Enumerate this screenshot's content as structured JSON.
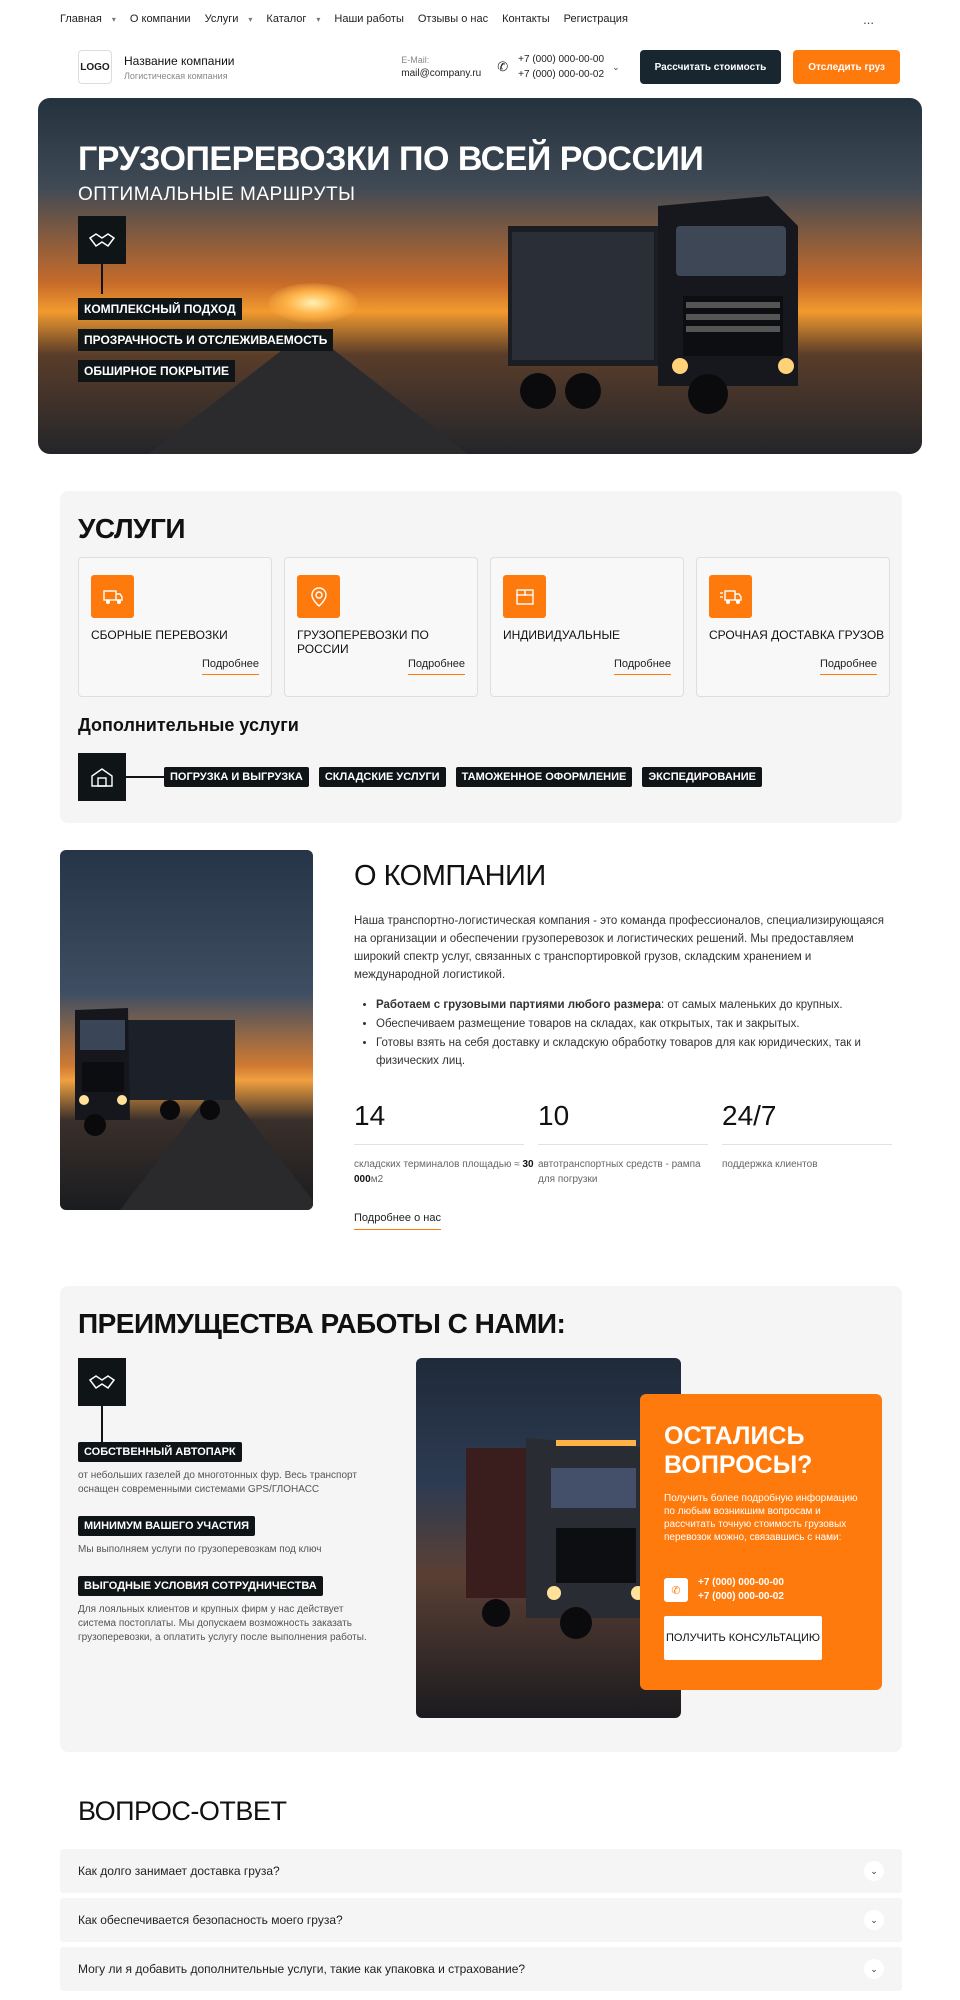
{
  "nav": {
    "items": [
      {
        "label": "Главная",
        "dropdown": true
      },
      {
        "label": "О компании",
        "dropdown": false
      },
      {
        "label": "Услуги",
        "dropdown": true
      },
      {
        "label": "Каталог",
        "dropdown": true
      },
      {
        "label": "Наши работы",
        "dropdown": false
      },
      {
        "label": "Отзывы о нас",
        "dropdown": false
      },
      {
        "label": "Контакты",
        "dropdown": false
      },
      {
        "label": "Регистрация",
        "dropdown": false
      }
    ],
    "more": "..."
  },
  "header": {
    "logo": "LOGO",
    "company_name": "Название компании",
    "company_sub": "Логистическая компания",
    "email_label": "E-Mail:",
    "email": "mail@company.ru",
    "phone1": "+7 (000) 000-00-00",
    "phone2": "+7 (000) 000-00-02",
    "btn_calc": "Рассчитать стоимость",
    "btn_track": "Отследить груз"
  },
  "hero": {
    "title": "ГРУЗОПЕРЕВОЗКИ ПО ВСЕЙ РОССИИ",
    "subtitle": "ОПТИМАЛЬНЫЕ МАРШРУТЫ",
    "tags": [
      "КОМПЛЕКСНЫЙ ПОДХОД",
      "ПРОЗРАЧНОСТЬ И ОТСЛЕЖИВАЕМОСТЬ",
      "ОБШИРНОЕ ПОКРЫТИЕ"
    ]
  },
  "services": {
    "title": "УСЛУГИ",
    "cards": [
      {
        "title": "СБОРНЫЕ ПЕРЕВОЗКИ",
        "more": "Подробнее",
        "icon": "box-truck-icon"
      },
      {
        "title": "ГРУЗОПЕРЕВОЗКИ ПО РОССИИ",
        "more": "Подробнее",
        "icon": "map-pin-icon"
      },
      {
        "title": "ИНДИВИДУАЛЬНЫЕ",
        "more": "Подробнее",
        "icon": "package-icon"
      },
      {
        "title": "СРОЧНАЯ ДОСТАВКА ГРУЗОВ",
        "more": "Подробнее",
        "icon": "fast-truck-icon"
      }
    ],
    "additional_title": "Дополнительные услуги",
    "additional": [
      "ПОГРУЗКА И ВЫГРУЗКА",
      "СКЛАДСКИЕ УСЛУГИ",
      "ТАМОЖЕННОЕ ОФОРМЛЕНИЕ",
      "ЭКСПЕДИРОВАНИЕ"
    ]
  },
  "about": {
    "title": "О КОМПАНИИ",
    "text": "Наша транспортно-логистическая компания - это команда профессионалов, специализирующаяся на организации и обеспечении грузоперевозок и логистических решений. Мы предоставляем широкий спектр услуг, связанных с транспортировкой грузов, складским хранением и международной логистикой.",
    "bullet1_bold": "Работаем с грузовыми партиями любого размера",
    "bullet1_rest": ": от самых маленьких до крупных.",
    "bullet2": "Обеспечиваем размещение товаров на складах, как открытых, так и закрытых.",
    "bullet3": "Готовы взять на себя доставку и складскую обработку товаров для как юридических, так и физических лиц.",
    "stats": [
      {
        "num": "14",
        "label_a": "складских терминалов площадью ≈ ",
        "label_b": "30 000",
        "label_c": "м2"
      },
      {
        "num": "10",
        "label_a": "автотранспортных средств - рампа для погрузки",
        "label_b": "",
        "label_c": ""
      },
      {
        "num": "24/7",
        "label_a": "поддержка клиентов",
        "label_b": "",
        "label_c": ""
      }
    ],
    "more": "Подробнее о нас"
  },
  "advantages": {
    "title": "ПРЕИМУЩЕСТВА РАБОТЫ С НАМИ:",
    "items": [
      {
        "tag": "СОБСТВЕННЫЙ АВТОПАРК",
        "text": "от небольших газелей до многотонных фур. Весь транспорт оснащен современными системами GPS/ГЛОНАСС"
      },
      {
        "tag": "МИНИМУМ ВАШЕГО УЧАСТИЯ",
        "text": "Мы выполняем услуги по грузоперевозкам под ключ"
      },
      {
        "tag": "ВЫГОДНЫЕ УСЛОВИЯ СОТРУДНИЧЕСТВА",
        "text": "Для лояльных клиентов и крупных фирм у нас действует система постоплаты. Мы допускаем возможность заказать грузоперевозки, а оплатить услугу после выполнения работы."
      }
    ],
    "cta": {
      "title_line1": "ОСТАЛИСЬ",
      "title_line2": "ВОПРОСЫ?",
      "text": "Получить более подробную информацию по любым возникшим вопросам и рассчитать точную стоимость грузовых перевозок можно, связавшись с нами:",
      "phone1": "+7 (000) 000-00-00",
      "phone2": "+7 (000) 000-00-02",
      "button": "ПОЛУЧИТЬ КОНСУЛЬТАЦИЮ"
    }
  },
  "faq": {
    "title": "ВОПРОС-ОТВЕТ",
    "items": [
      "Как долго занимает доставка груза?",
      "Как обеспечивается безопасность моего груза?",
      "Могу ли я добавить дополнительные услуги, такие как упаковка и страхование?"
    ]
  },
  "colors": {
    "accent": "#ff7a0d",
    "dark": "#0f1417",
    "button_dark": "#17262f",
    "panel": "#f5f5f6"
  }
}
